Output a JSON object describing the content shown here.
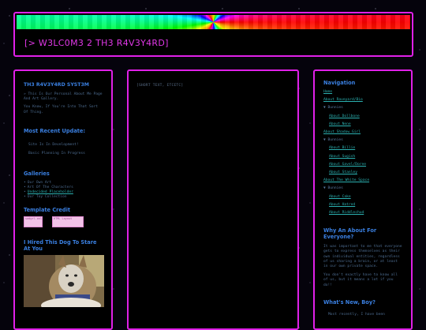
{
  "header": {
    "title": "[> W3LC0M3 2 TH3 R4V3Y4RD]"
  },
  "left": {
    "system_title": "TH3 R4V3Y4RD SYST3M",
    "intro_1": "» This Is Our Personal About Me Page And Art Gallery.",
    "intro_2": "You Know, If You're Into That Sort Of Thing.",
    "update_heading": "Most Recent Update:",
    "updates": [
      "Site Is In Development!",
      "Basic Planning In Progress"
    ],
    "galleries_heading": "Galleries",
    "galleries": [
      {
        "label": "Our Own Art",
        "link": false
      },
      {
        "label": "Art Of The Characters",
        "link": false
      },
      {
        "label": "Undecided Placeholder",
        "link": true
      },
      {
        "label": "Our Toy Collection",
        "link": false
      }
    ],
    "credit_heading": "Template Credit",
    "credit_badge_1": "sadgrl.onl",
    "credit_badge_2": "HTML Layout",
    "dog_heading": "I Hired This Dog To Stare At You"
  },
  "center": {
    "text": "[SHORT TEXT, ETCETC]"
  },
  "right": {
    "nav_heading": "Navigation",
    "nav": {
      "home": "Home",
      "about_raveyard": "About Raveyard/Bio",
      "cat_1": "▼ Bunnies",
      "about_dollbone": "About Dollbone",
      "about_nene": "About Nene",
      "about_shadow_girl": "About Shadow Girl",
      "cat_2": "▼ Bunnies",
      "about_billie": "About Billie",
      "about_sugish": "About Sugish",
      "about_gavel": "About Gavel/Doree",
      "about_stanley": "About Stanley",
      "about_white_space": "About The White Space",
      "cat_3": "▼ Bunnies",
      "about_cake": "About Cake",
      "about_hatred": "About Hatred",
      "about_riddlechud": "About Riddlechud"
    },
    "why_heading": "Why An About For Everyone?",
    "why_text_1": "It was important to me that everyone gets to express themselves as their own individual entities, regardless of us sharing a brain, or at least in our own private space.",
    "why_text_2": "You don't exactly have to know all of us, but it means a lot if you do!!",
    "new_heading": "What's New, Boy?",
    "new_text": "Most recently, I have been"
  },
  "colors": {
    "frame": "#e020e8",
    "title": "#e238e8",
    "heading": "#3a7fe0",
    "link": "#2bb0b0",
    "body_text": "#4d6c90"
  }
}
